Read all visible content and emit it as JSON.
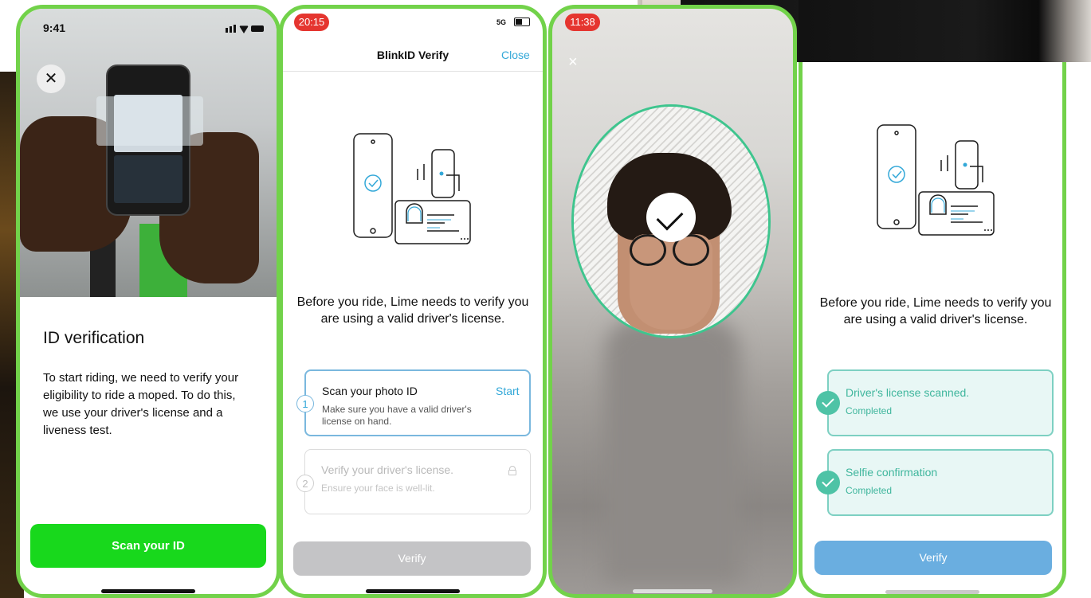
{
  "colors": {
    "frame_green": "#72d24a",
    "lime_green": "#18d81c",
    "blink_blue": "#33a8d8",
    "teal": "#4ec3a6",
    "verify_disabled": "#c4c4c6",
    "verify_blue": "#6aaee0"
  },
  "screen1": {
    "status_time": "9:41",
    "close_icon": "close-icon",
    "title": "ID verification",
    "body": "To start riding, we need to verify your eligibility to ride a moped. To do this, we use your driver's license and a liveness test.",
    "button_label": "Scan your ID"
  },
  "screen2": {
    "status_time": "20:15",
    "network": "5G",
    "header_title": "BlinkID Verify",
    "close_label": "Close",
    "caption": "Before you ride, Lime needs to verify you are using a valid driver's license.",
    "step1": {
      "number": "1",
      "title": "Scan your photo ID",
      "subtitle": "Make sure you have a valid driver's license on hand.",
      "action": "Start"
    },
    "step2": {
      "number": "2",
      "title": "Verify your driver's license.",
      "subtitle": "Ensure your face is well-lit."
    },
    "verify_label": "Verify"
  },
  "screen3": {
    "status_time": "11:38",
    "close_glyph": "×"
  },
  "screen4": {
    "caption": "Before you ride, Lime needs to verify you are using a valid driver's license.",
    "item1": {
      "title": "Driver's license scanned.",
      "status": "Completed"
    },
    "item2": {
      "title": "Selfie confirmation",
      "status": "Completed"
    },
    "verify_label": "Verify"
  }
}
